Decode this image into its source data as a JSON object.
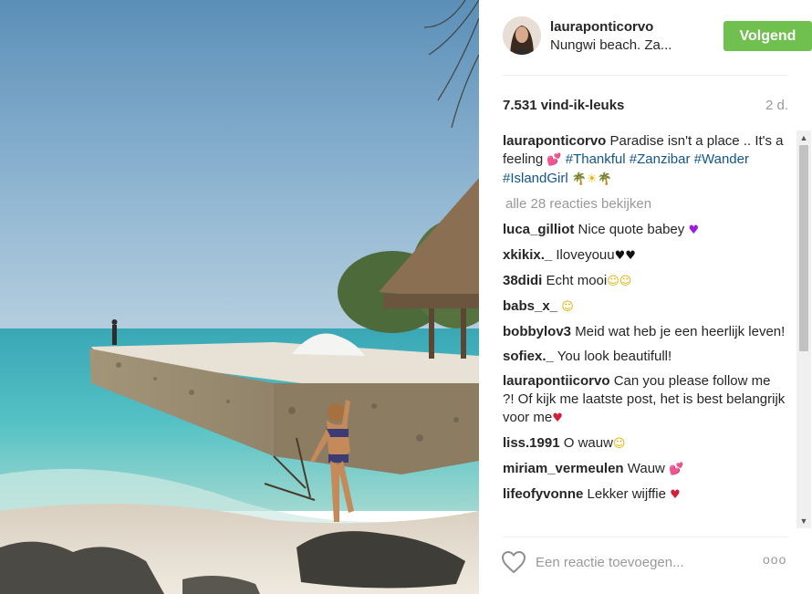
{
  "post": {
    "username": "lauraponticorvo",
    "location": "Nungwi beach. Za...",
    "follow_label": "Volgend",
    "likes": "7.531 vind-ik-leuks",
    "time": "2 d."
  },
  "caption": {
    "user": "lauraponticorvo",
    "text": "Paradise isn't a place .. It's a feeling",
    "emoji1": "💕",
    "tags": [
      "#Thankful",
      "#Zanzibar",
      "#Wander",
      "#IslandGirl"
    ],
    "emoji2": "🌴☀🌴"
  },
  "view_all": "alle 28 reacties bekijken",
  "comments": [
    {
      "user": "luca_gilliot",
      "text": "Nice quote babey",
      "emoji": "♥"
    },
    {
      "user": "xkikix._",
      "text": "Iloveyouu",
      "emoji": "♥♥"
    },
    {
      "user": "38didi",
      "text": "Echt mooi",
      "emoji": "☺☺"
    },
    {
      "user": "babs_x_",
      "text": "",
      "emoji": "☺"
    },
    {
      "user": "bobbylov3",
      "text": "Meid wat heb je een heerlijk leven!",
      "emoji": ""
    },
    {
      "user": "sofiex._",
      "text": "You look beautifull!",
      "emoji": ""
    },
    {
      "user": "laurapontiicorvo",
      "text": "Can you please follow me ?! Of kijk me laatste post, het is best belangrijk voor me",
      "emoji": "♥"
    },
    {
      "user": "liss.1991",
      "text": "O wauw",
      "emoji": "☺"
    },
    {
      "user": "miriam_vermeulen",
      "text": "Wauw",
      "emoji": "💕"
    },
    {
      "user": "lifeofyvonne",
      "text": "Lekker wijffie",
      "emoji": "♥"
    }
  ],
  "input": {
    "placeholder": "Een reactie toevoegen..."
  },
  "more_label": "ooo",
  "icons": {
    "heart": "heart-outline-icon",
    "scroll_up": "▲",
    "scroll_down": "▼"
  },
  "colors": {
    "follow_green": "#70c050",
    "hashtag_blue": "#125688",
    "muted_gray": "#999999"
  }
}
